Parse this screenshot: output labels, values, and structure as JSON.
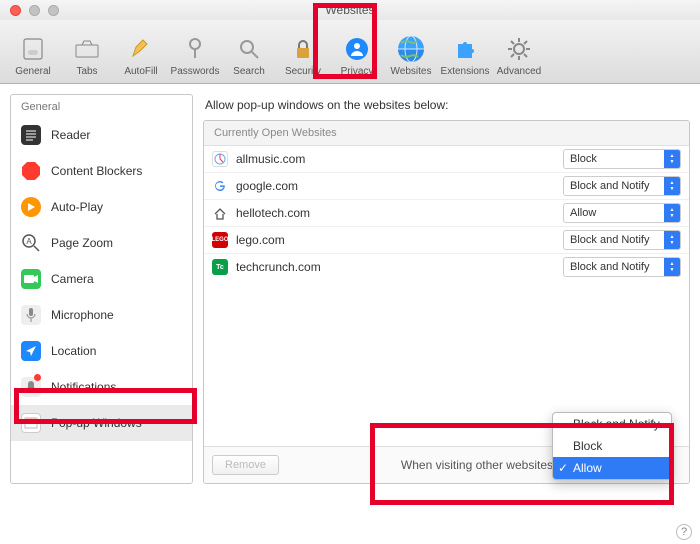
{
  "window": {
    "title": "Websites"
  },
  "toolbar": [
    {
      "id": "general",
      "label": "General"
    },
    {
      "id": "tabs",
      "label": "Tabs"
    },
    {
      "id": "autofill",
      "label": "AutoFill"
    },
    {
      "id": "passwords",
      "label": "Passwords"
    },
    {
      "id": "search",
      "label": "Search"
    },
    {
      "id": "security",
      "label": "Security"
    },
    {
      "id": "privacy",
      "label": "Privacy"
    },
    {
      "id": "websites",
      "label": "Websites"
    },
    {
      "id": "extensions",
      "label": "Extensions"
    },
    {
      "id": "advanced",
      "label": "Advanced"
    }
  ],
  "sidebar": {
    "heading": "General",
    "items": [
      {
        "id": "reader",
        "label": "Reader"
      },
      {
        "id": "content-blockers",
        "label": "Content Blockers"
      },
      {
        "id": "auto-play",
        "label": "Auto-Play"
      },
      {
        "id": "page-zoom",
        "label": "Page Zoom"
      },
      {
        "id": "camera",
        "label": "Camera"
      },
      {
        "id": "microphone",
        "label": "Microphone"
      },
      {
        "id": "location",
        "label": "Location"
      },
      {
        "id": "notifications",
        "label": "Notifications"
      },
      {
        "id": "popup-windows",
        "label": "Pop-up Windows",
        "selected": true
      }
    ]
  },
  "panel": {
    "title": "Allow pop-up windows on the websites below:",
    "currently_open_heading": "Currently Open Websites",
    "sites": [
      {
        "domain": "allmusic.com",
        "setting": "Block"
      },
      {
        "domain": "google.com",
        "setting": "Block and Notify"
      },
      {
        "domain": "hellotech.com",
        "setting": "Allow"
      },
      {
        "domain": "lego.com",
        "setting": "Block and Notify"
      },
      {
        "domain": "techcrunch.com",
        "setting": "Block and Notify"
      }
    ],
    "remove_label": "Remove",
    "other_label": "When visiting other websites",
    "other_menu": {
      "options": [
        "Block and Notify",
        "Block",
        "Allow"
      ],
      "selected": "Allow"
    }
  }
}
